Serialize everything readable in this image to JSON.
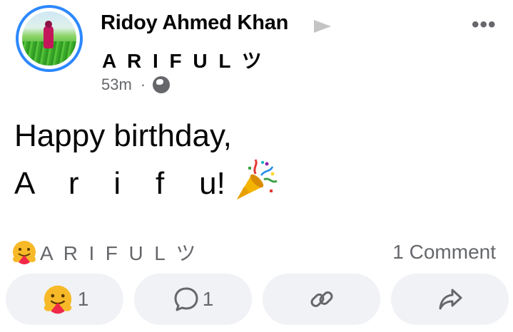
{
  "post": {
    "author_name": "Ridoy Ahmed Khan",
    "target_name": "A R I F U L ツ",
    "time": "53m",
    "separator": "·",
    "privacy_icon": "globe-icon",
    "more_label": "•••",
    "text_line1": "Happy birthday,",
    "text_line2": "A    r    i    f    u!"
  },
  "reactions": {
    "reactor_names": "A  R  I  F  U  L  ツ",
    "comment_count_label": "1 Comment"
  },
  "actions": {
    "care_count": "1",
    "comment_count": "1"
  },
  "colors": {
    "ring": "#2d88ff",
    "secondary_text": "#65676b",
    "button_bg": "#f0f2f5"
  }
}
